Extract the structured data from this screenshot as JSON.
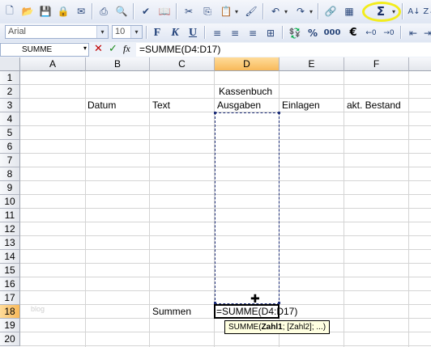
{
  "toolbar": {
    "font_name": "Arial",
    "font_size": "10",
    "bold": "F",
    "italic": "K",
    "underline": "U",
    "percent": "%",
    "thousands": "000",
    "euro": "€",
    "autosum": "Σ",
    "icons": [
      "new-icon",
      "open-icon",
      "save-icon",
      "permission-icon",
      "email-icon",
      "print-icon",
      "print-preview-icon",
      "spellcheck-icon",
      "research-icon",
      "cut-icon",
      "copy-icon",
      "paste-icon",
      "format-painter-icon",
      "undo-icon",
      "redo-icon",
      "hyperlink-icon",
      "chart-icon",
      "autosum-icon",
      "sort-ascending-icon",
      "sort-descending-icon"
    ],
    "highlight_color": "#f2ec1c"
  },
  "formula_bar": {
    "name_box": "SUMME",
    "cancel": "✕",
    "enter": "✓",
    "fx": "fx",
    "formula": "=SUMME(D4:D17)"
  },
  "columns": [
    "A",
    "B",
    "C",
    "D",
    "E",
    "F"
  ],
  "rows": [
    "1",
    "2",
    "3",
    "4",
    "5",
    "6",
    "7",
    "8",
    "9",
    "10",
    "11",
    "12",
    "13",
    "14",
    "15",
    "16",
    "17",
    "18",
    "19",
    "20"
  ],
  "cells": {
    "title": "Kassenbuch",
    "datum": "Datum",
    "text": "Text",
    "ausgaben": "Ausgaben",
    "einlagen": "Einlagen",
    "bestand": "akt. Bestand",
    "summen": "Summen",
    "active_input": "=SUMME(D4:D17)"
  },
  "tooltip": {
    "func": "SUMME(",
    "arg1": "Zahl1",
    "rest": "; [Zahl2]; ...)"
  },
  "watermark": "blog",
  "selection": {
    "active_cell": "D18",
    "range": "D4:D17"
  }
}
